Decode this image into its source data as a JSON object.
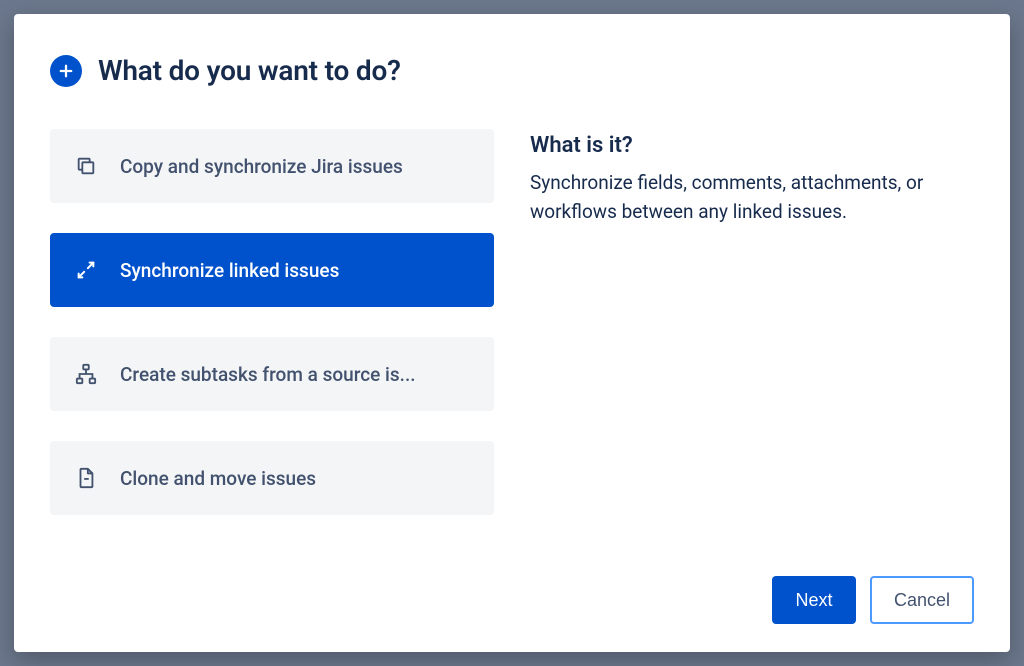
{
  "header": {
    "title": "What do you want to do?"
  },
  "options": [
    {
      "id": "copy-sync",
      "label": "Copy and synchronize Jira issues",
      "selected": false,
      "icon": "copy-icon"
    },
    {
      "id": "sync-linked",
      "label": "Synchronize linked issues",
      "selected": true,
      "icon": "sync-arrows-icon"
    },
    {
      "id": "create-subtasks",
      "label": "Create subtasks from a source is...",
      "selected": false,
      "icon": "hierarchy-icon"
    },
    {
      "id": "clone-move",
      "label": "Clone and move issues",
      "selected": false,
      "icon": "document-icon"
    }
  ],
  "detail": {
    "title": "What is it?",
    "text": "Synchronize fields, comments, attachments, or workflows between any linked issues."
  },
  "footer": {
    "next": "Next",
    "cancel": "Cancel"
  },
  "colors": {
    "primary": "#0052cc",
    "text": "#172b4d",
    "muted": "#42526e",
    "panel": "#f4f5f7",
    "focusBorder": "#4c9aff"
  }
}
